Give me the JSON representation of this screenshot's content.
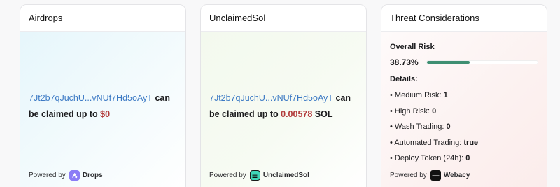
{
  "airdrops": {
    "title": "Airdrops",
    "address": "7Jt2b7qJuchU...vNUf7Hd5oAyT",
    "claim_text": "can be claimed up to",
    "amount": "$0",
    "powered_label": "Powered by",
    "brand": "Drops",
    "brand_icon": "drops-logo-icon",
    "brand_color": "#8b7cf6"
  },
  "unclaimed": {
    "title": "UnclaimedSol",
    "address": "7Jt2b7qJuchU...vNUf7Hd5oAyT",
    "claim_text": "can be claimed up to",
    "amount": "0.00578",
    "unit": "SOL",
    "powered_label": "Powered by",
    "brand": "UnclaimedSol",
    "brand_icon": "unclaimedsol-logo-icon",
    "brand_color": "#3fd6b8"
  },
  "threat": {
    "title": "Threat Considerations",
    "overall_label": "Overall Risk",
    "overall_value": "38.73%",
    "overall_fraction": 0.3873,
    "bar_color": "#3e8f72",
    "details_label": "Details:",
    "details": [
      {
        "label": "Medium Risk:",
        "value": "1"
      },
      {
        "label": "High Risk:",
        "value": "0"
      },
      {
        "label": "Wash Trading:",
        "value": "0"
      },
      {
        "label": "Automated Trading:",
        "value": "true"
      },
      {
        "label": "Deploy Token (24h):",
        "value": "0"
      }
    ],
    "powered_label": "Powered by",
    "brand": "Webacy",
    "brand_icon": "webacy-logo-icon"
  },
  "colors": {
    "address": "#3b79c4",
    "amount": "#b23a3a"
  }
}
